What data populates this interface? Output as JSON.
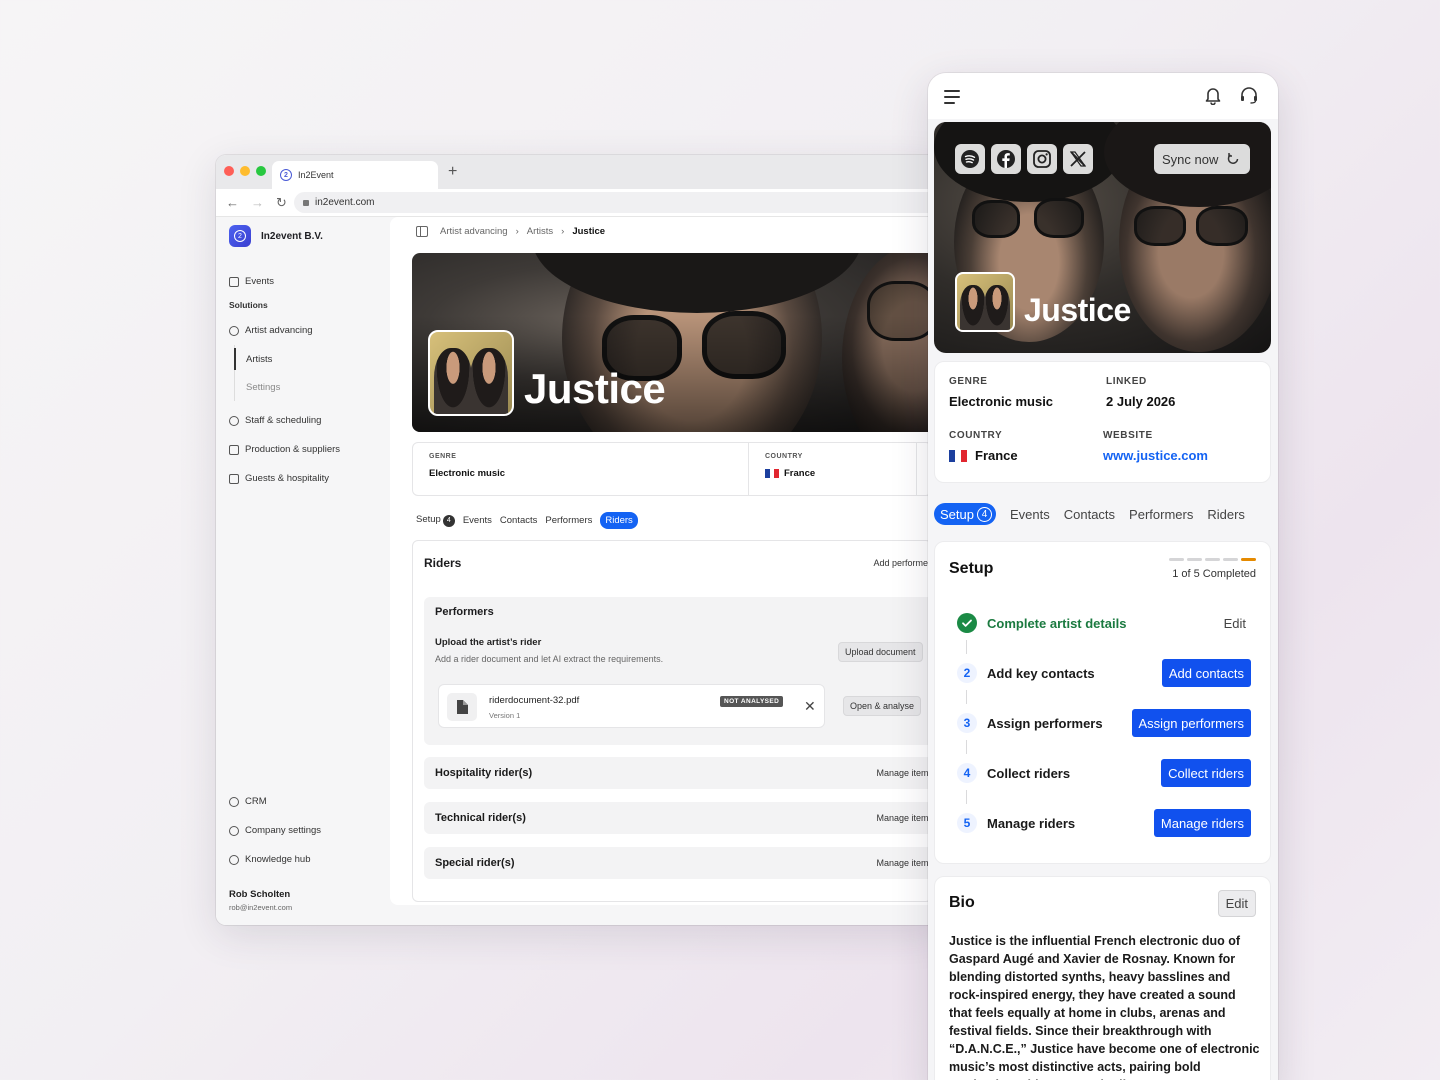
{
  "browser": {
    "tab_title": "In2Event",
    "url": "in2event.com",
    "org_name": "In2event B.V.",
    "nav": {
      "events": "Events",
      "solutions_label": "Solutions",
      "artist_advancing": "Artist advancing",
      "artists": "Artists",
      "settings": "Settings",
      "staff": "Staff & scheduling",
      "production": "Production & suppliers",
      "guests": "Guests & hospitality",
      "crm": "CRM",
      "company_settings": "Company settings",
      "knowledge_hub": "Knowledge hub"
    },
    "user": {
      "name": "Rob Scholten",
      "email": "rob@in2event.com"
    },
    "breadcrumb": [
      "Artist advancing",
      "Artists",
      "Justice"
    ],
    "artist_name": "Justice",
    "meta": {
      "genre_label": "GENRE",
      "genre": "Electronic music",
      "country_label": "COUNTRY",
      "country": "France"
    },
    "tabs": {
      "setup": "Setup",
      "setup_badge": "4",
      "events": "Events",
      "contacts": "Contacts",
      "performers": "Performers",
      "riders": "Riders"
    },
    "riders": {
      "title": "Riders",
      "add_performer": "Add performer",
      "performers_title": "Performers",
      "upload_title": "Upload the artist’s rider",
      "upload_desc": "Add a rider document and let AI extract the requirements.",
      "upload_button": "Upload document",
      "file_name": "riderdocument-32.pdf",
      "file_version": "Version 1",
      "file_status": "NOT ANALYSED",
      "open_analyse": "Open & analyse",
      "rows": [
        {
          "title": "Hospitality rider(s)",
          "action": "Manage items"
        },
        {
          "title": "Technical rider(s)",
          "action": "Manage items"
        },
        {
          "title": "Special rider(s)",
          "action": "Manage items"
        }
      ]
    }
  },
  "mobile": {
    "sync_now": "Sync now",
    "artist_name": "Justice",
    "genre_label": "GENRE",
    "genre": "Electronic music",
    "linked_label": "LINKED",
    "linked": "2 July 2026",
    "country_label": "COUNTRY",
    "country": "France",
    "website_label": "WEBSITE",
    "website": "www.justice.com",
    "tabs": {
      "setup": "Setup",
      "setup_badge": "4",
      "events": "Events",
      "contacts": "Contacts",
      "performers": "Performers",
      "riders": "Riders"
    },
    "setup": {
      "title": "Setup",
      "progress_text": "1 of 5 Completed",
      "progress_done": 1,
      "progress_total": 5,
      "steps": [
        {
          "num": "1",
          "label": "Complete artist details",
          "action": "Edit"
        },
        {
          "num": "2",
          "label": "Add key contacts",
          "action": "Add contacts"
        },
        {
          "num": "3",
          "label": "Assign performers",
          "action": "Assign performers"
        },
        {
          "num": "4",
          "label": "Collect riders",
          "action": "Collect riders"
        },
        {
          "num": "5",
          "label": "Manage riders",
          "action": "Manage riders"
        }
      ]
    },
    "bio": {
      "title": "Bio",
      "edit": "Edit",
      "text": "Justice is the influential French electronic duo of Gaspard Augé and Xavier de Rosnay. Known for blending distorted synths, heavy basslines and rock-inspired energy, they have created a sound that feels equally at home in clubs, arenas and festival fields. Since their breakthrough with “D.A.N.C.E.,” Justice have become one of electronic music’s most distinctive acts, pairing bold production with spectacular live"
    }
  },
  "colors": {
    "accent": "#1463f3",
    "button": "#1151ee",
    "success": "#1b8a45",
    "progress": "#e58a00",
    "brand": "#4c62f0"
  },
  "icons": [
    "spotify-icon",
    "facebook-icon",
    "instagram-icon",
    "x-icon",
    "bell-icon",
    "headset-icon",
    "menu-icon",
    "sync-icon",
    "file-icon",
    "close-icon",
    "check-icon"
  ]
}
